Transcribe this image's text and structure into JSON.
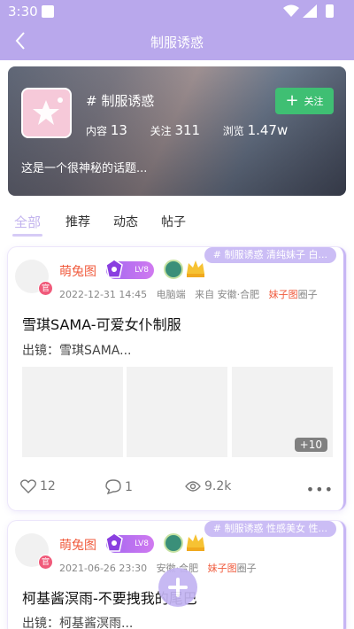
{
  "status_bar": {
    "time": "3:30"
  },
  "header": {
    "title": "制服诱惑"
  },
  "topic": {
    "name": "# 制服诱惑",
    "content_label": "内容",
    "content_count": "13",
    "follow_label": "关注",
    "follow_count": "311",
    "views_label": "浏览",
    "views_count": "1.47w",
    "follow_button": "关注",
    "description": "这是一个很神秘的话题..."
  },
  "tabs": [
    {
      "label": "全部",
      "active": true
    },
    {
      "label": "推荐",
      "active": false
    },
    {
      "label": "动态",
      "active": false
    },
    {
      "label": "帖子",
      "active": false
    }
  ],
  "posts": [
    {
      "tags": "# 制服诱惑  清纯妹子  白...",
      "official_badge": "官",
      "author": "萌兔图",
      "level": "LV8",
      "date": "2022-12-31 14:45",
      "device": "电脑端",
      "location": "来自 安徽·合肥",
      "circle_name": "妹子图",
      "circle_suffix": "圈子",
      "title": "雪琪SAMA-可爱女仆制服",
      "excerpt": "出镜：雪琪SAMA...",
      "more_images": "+10",
      "likes": "12",
      "comments": "1",
      "views": "9.2k"
    },
    {
      "tags": "# 制服诱惑  性感美女  性...",
      "official_badge": "官",
      "author": "萌兔图",
      "level": "LV8",
      "date": "2021-06-26 23:30",
      "location": "安徽·合肥",
      "circle_name": "妹子图",
      "circle_suffix": "圈子",
      "title": "柯基酱溟雨-不要拽我的尾巴",
      "excerpt": "出镜：柯基酱溟雨..."
    }
  ],
  "colors": {
    "accent": "#b9a8ec",
    "follow_green": "#3fbf73",
    "author_orange": "#f05a3c"
  }
}
